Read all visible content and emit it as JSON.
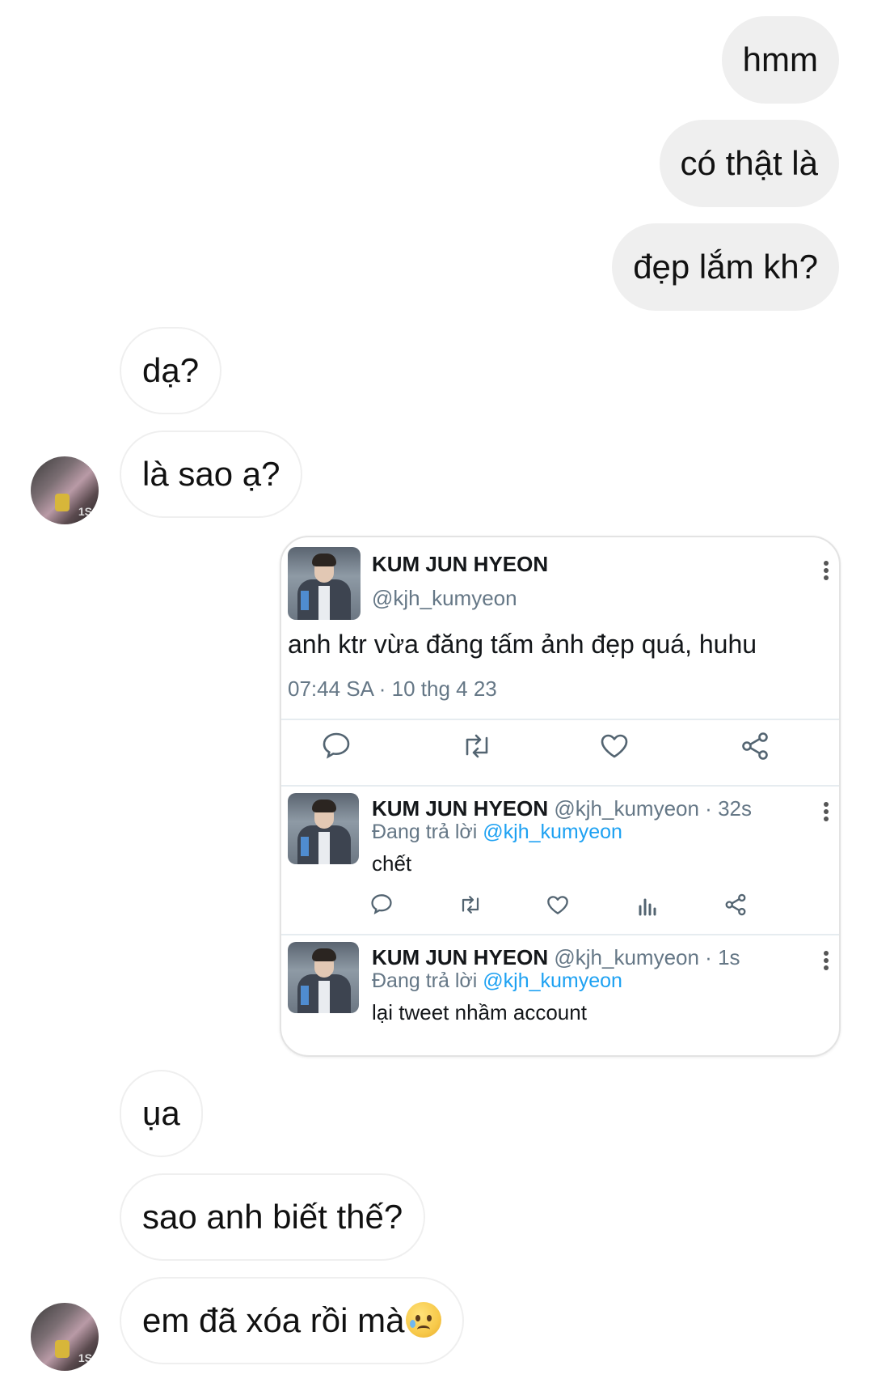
{
  "messages_out": [
    {
      "text": "hmm"
    },
    {
      "text": "có thật là"
    },
    {
      "text": "đẹp lắm kh?"
    }
  ],
  "messages_in_top": [
    {
      "text": "dạ?"
    },
    {
      "text": "là sao ạ?"
    }
  ],
  "messages_in_bottom": [
    {
      "text": "ụa"
    },
    {
      "text": "sao anh biết thế?"
    },
    {
      "text": "em đã xóa rồi mà"
    }
  ],
  "contact_avatar_text": "1S",
  "shared_tweet": {
    "author_name": "KUM JUN HYEON",
    "author_handle": "@kjh_kumyeon",
    "text": "anh ktr vừa đăng tấm ảnh đẹp quá, huhu",
    "timestamp": "07:44 SA · 10 thg 4 23",
    "actions": [
      "reply-icon",
      "retweet-icon",
      "like-icon",
      "share-icon"
    ],
    "replies": [
      {
        "author_name": "KUM JUN HYEON",
        "meta": "@kjh_kumyeon · 32s",
        "replying_prefix": "Đang trả lời ",
        "replying_to": "@kjh_kumyeon",
        "text": "chết"
      },
      {
        "author_name": "KUM JUN HYEON",
        "meta": "@kjh_kumyeon · 1s",
        "replying_prefix": "Đang trả lời ",
        "replying_to": "@kjh_kumyeon",
        "text": "lại tweet nhầm account"
      }
    ]
  },
  "colors": {
    "link": "#1da1f2",
    "bubble_out": "#efefef",
    "muted": "#657786"
  },
  "emoji": "sad-tear-emoji"
}
